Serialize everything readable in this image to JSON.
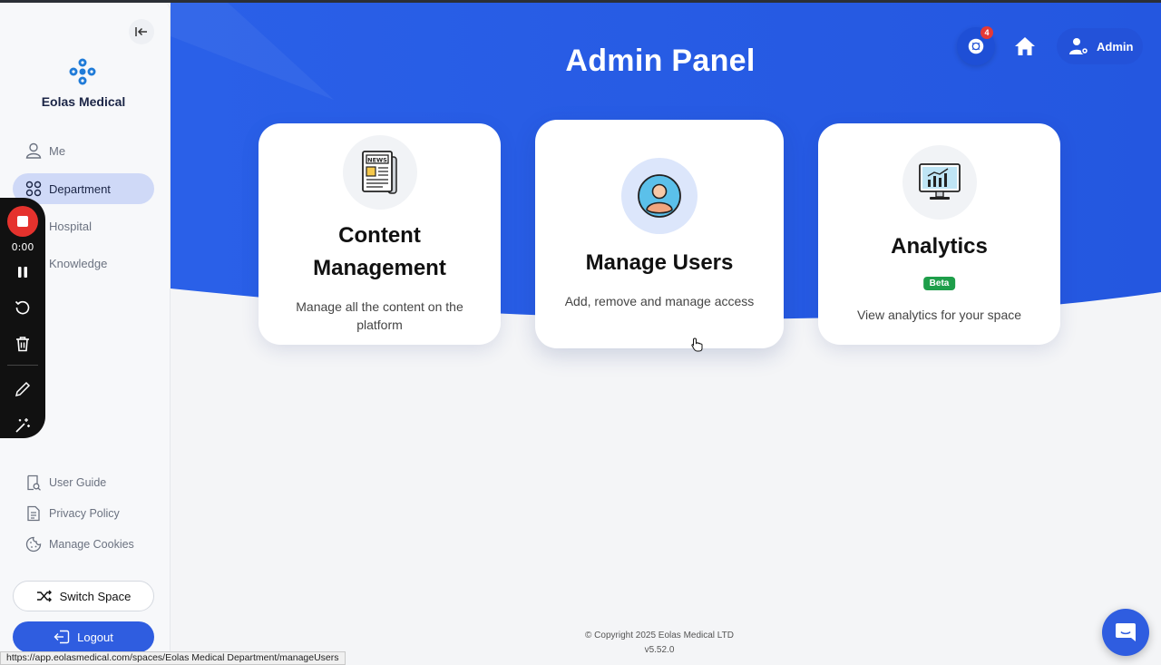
{
  "header": {
    "title": "Admin Panel",
    "notification_count": "4",
    "admin_label": "Admin"
  },
  "sidebar": {
    "brand": "Eolas Medical",
    "nav": [
      {
        "label": "Me",
        "icon": "user-icon"
      },
      {
        "label": "Department",
        "icon": "department-icon",
        "active": true
      },
      {
        "label": "Hospital",
        "icon": "hospital-icon"
      },
      {
        "label": "Knowledge",
        "icon": "knowledge-icon"
      }
    ],
    "footer_links": [
      {
        "label": "User Guide",
        "icon": "user-guide-icon"
      },
      {
        "label": "Privacy Policy",
        "icon": "document-icon"
      },
      {
        "label": "Manage Cookies",
        "icon": "cookie-icon"
      }
    ],
    "switch_space": "Switch Space",
    "logout": "Logout"
  },
  "cards": [
    {
      "title": "Content Management",
      "description": "Manage all the content on the platform",
      "icon": "newspaper-icon"
    },
    {
      "title": "Manage Users",
      "description": "Add, remove and manage access",
      "icon": "user-avatar-icon"
    },
    {
      "title": "Analytics",
      "badge": "Beta",
      "description": "View analytics for your space",
      "icon": "analytics-monitor-icon"
    }
  ],
  "recorder": {
    "time": "0:00"
  },
  "footer": {
    "copyright": "© Copyright 2025 Eolas Medical LTD",
    "version": "v5.52.0"
  },
  "status_bar": {
    "url": "https://app.eolasmedical.com/spaces/Eolas Medical Department/manageUsers"
  },
  "colors": {
    "primary": "#2f5de0",
    "hero_blue": "#2b5ce6",
    "active_nav": "#cfd9f7",
    "beta_green": "#1e9e4a",
    "recording_red": "#e5322d"
  }
}
